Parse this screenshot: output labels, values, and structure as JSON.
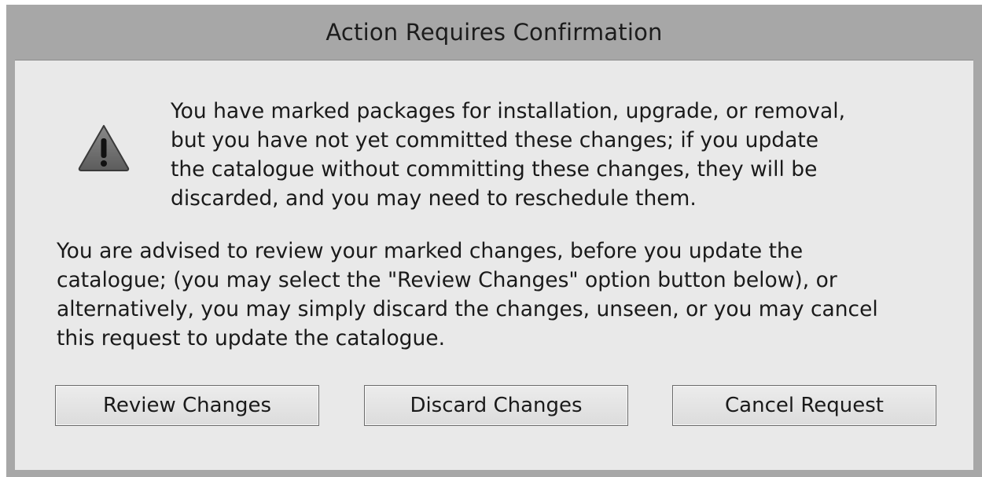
{
  "dialog": {
    "title": "Action Requires Confirmation",
    "message": "You have marked packages for installation, upgrade, or removal,\nbut you have not yet committed these changes; if you update\nthe catalogue without committing these changes, they will be\ndiscarded, and you may need to reschedule them.",
    "advice": "You are advised to review your marked changes, before you update the\ncatalogue; (you may select the \"Review Changes\" option button below), or\nalternatively, you may simply discard the changes, unseen, or you may cancel\nthis request to update the catalogue.",
    "icon": "warning-icon"
  },
  "buttons": {
    "review": "Review Changes",
    "discard": "Discard Changes",
    "cancel": "Cancel Request"
  },
  "colors": {
    "frame": "#a7a7a7",
    "client": "#e9e9e9",
    "icon_fill": "#6e6e6e",
    "icon_mark": "#111111"
  }
}
